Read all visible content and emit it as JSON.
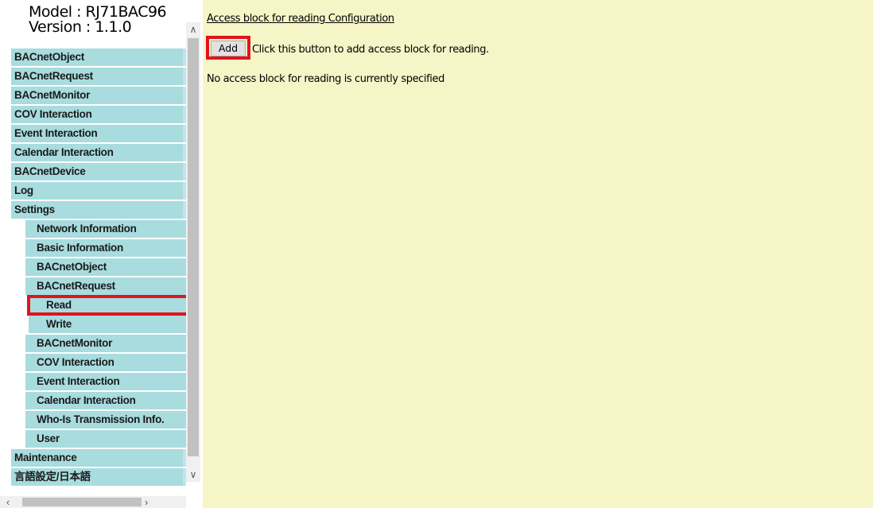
{
  "header": {
    "model": "Model : RJ71BAC96",
    "version": "Version : 1.1.0"
  },
  "menu": [
    {
      "label": "BACnetObject",
      "level": 1
    },
    {
      "label": "BACnetRequest",
      "level": 1
    },
    {
      "label": "BACnetMonitor",
      "level": 1
    },
    {
      "label": "COV Interaction",
      "level": 1
    },
    {
      "label": "Event Interaction",
      "level": 1
    },
    {
      "label": "Calendar Interaction",
      "level": 1
    },
    {
      "label": "BACnetDevice",
      "level": 1
    },
    {
      "label": "Log",
      "level": 1
    },
    {
      "label": "Settings",
      "level": 1
    },
    {
      "label": "Network Information",
      "level": 2
    },
    {
      "label": "Basic Information",
      "level": 2
    },
    {
      "label": "BACnetObject",
      "level": 2
    },
    {
      "label": "BACnetRequest",
      "level": 2
    },
    {
      "label": "Read",
      "level": 3,
      "selected": true
    },
    {
      "label": "Write",
      "level": 3
    },
    {
      "label": "BACnetMonitor",
      "level": 2
    },
    {
      "label": "COV Interaction",
      "level": 2
    },
    {
      "label": "Event Interaction",
      "level": 2
    },
    {
      "label": "Calendar Interaction",
      "level": 2
    },
    {
      "label": "Who-Is Transmission Info.",
      "level": 2
    },
    {
      "label": "User",
      "level": 2
    },
    {
      "label": "Maintenance",
      "level": 1
    },
    {
      "label": "言語設定/日本語",
      "level": 1
    }
  ],
  "main": {
    "config_link": "Access block for reading Configuration",
    "add_button": "Add",
    "add_hint": "Click this button to add access block for reading.",
    "status_message": "No access block for reading is currently specified"
  },
  "icons": {
    "scroll_up": "chevron-up-icon",
    "scroll_down": "chevron-down-icon",
    "scroll_left": "chevron-left-icon",
    "scroll_right": "chevron-right-icon"
  },
  "colors": {
    "menu_bg": "#a8dcdf",
    "content_bg": "#f5f5c8",
    "highlight": "#e0141e"
  }
}
